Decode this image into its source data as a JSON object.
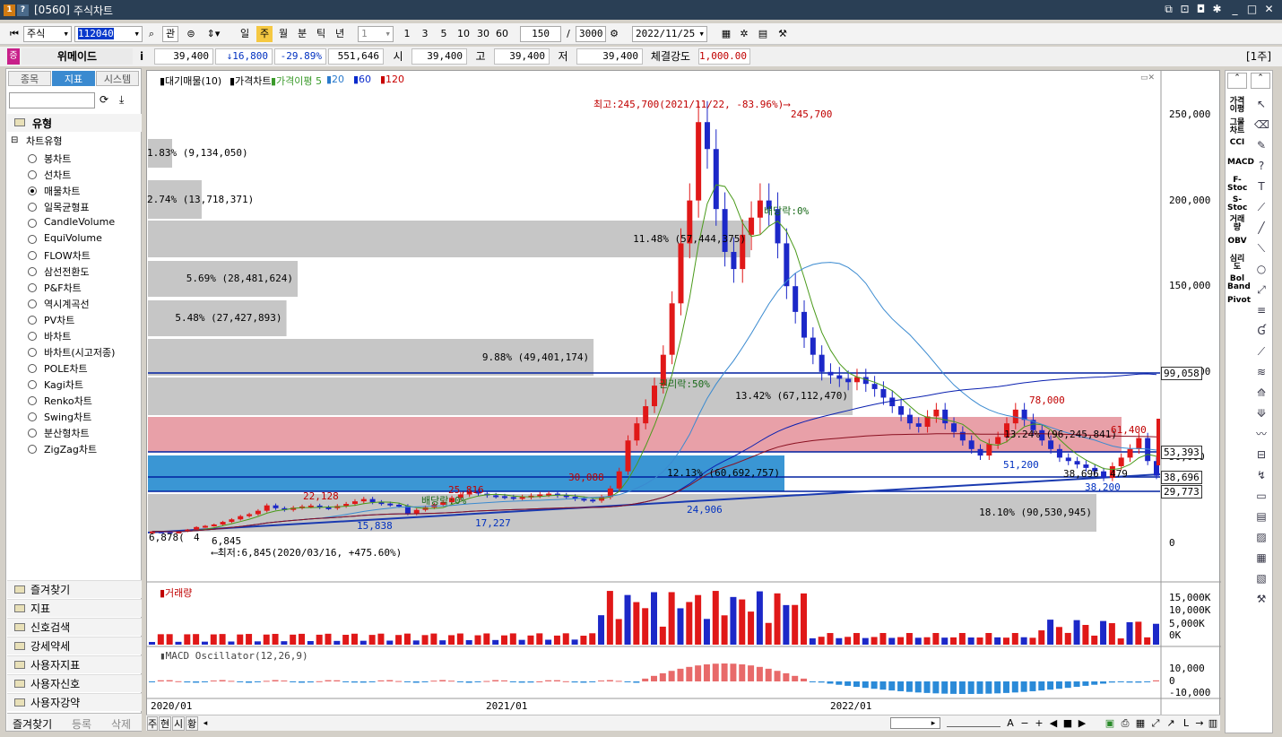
{
  "window": {
    "id": "[0560]",
    "title": "주식차트"
  },
  "toolbar": {
    "market": "주식",
    "code": "112040",
    "btn_gwan": "관",
    "periods": [
      "일",
      "주",
      "월",
      "분",
      "틱",
      "년"
    ],
    "nlist": "1",
    "nums": [
      "1",
      "3",
      "5",
      "10",
      "30",
      "60"
    ],
    "count": "150",
    "sep": "/",
    "max": "3000",
    "date": "2022/11/25"
  },
  "info": {
    "tag": "증",
    "name": "위메이드",
    "i": "i",
    "price": "39,400",
    "change": "↓16,800",
    "pct": "-29.89%",
    "volume": "551,646",
    "open_lbl": "시",
    "open": "39,400",
    "high_lbl": "고",
    "high": "39,400",
    "low_lbl": "저",
    "low": "39,400",
    "str_lbl": "체결강도",
    "strength": "1,000.00",
    "period": "[1주]"
  },
  "left": {
    "tabs": [
      "종목",
      "지표",
      "시스템"
    ],
    "section": "유형",
    "tree_root": "차트유형",
    "types": [
      "봉차트",
      "선차트",
      "매물차트",
      "일목균형표",
      "CandleVolume",
      "EquiVolume",
      "FLOW차트",
      "삼선전환도",
      "P&F차트",
      "역시계곡선",
      "PV차트",
      "바차트",
      "바차트(시고저종)",
      "POLE차트",
      "Kagi차트",
      "Renko차트",
      "Swing차트",
      "분산형차트",
      "ZigZag차트"
    ],
    "selected_index": 2,
    "folders": [
      "즐겨찾기",
      "지표",
      "신호검색",
      "강세약세",
      "사용자지표",
      "사용자신호",
      "사용자강약"
    ],
    "footer": [
      "즐겨찾기",
      "등록",
      "삭제"
    ]
  },
  "chart": {
    "legend": [
      "▮대기매물(10)",
      "▮가격차트",
      "▮가격이평 5",
      "▮20",
      "▮60",
      "▮120"
    ],
    "legend_colors": [
      "#000000",
      "#000000",
      "#3a9a2a",
      "#2a7acc",
      "#0a2acc",
      "#c80000"
    ],
    "vp": [
      {
        "label": "1.83% (9,134,050)",
        "fill": 0.25
      },
      {
        "label": "2.74% (13,718,371)",
        "fill": 0.37
      },
      {
        "label": "11.48% (57,444,375)",
        "fill": 1.0
      },
      {
        "label": "5.69% (28,481,624)",
        "fill": 0.5
      },
      {
        "label": "5.48% (27,427,893)",
        "fill": 0.48
      },
      {
        "label": "9.88% (49,401,174)",
        "fill": 0.86
      },
      {
        "label": "13.42% (67,112,470)",
        "fill": 1.0
      },
      {
        "label": "13.24% (96,245,841)",
        "fill": 1.0
      },
      {
        "label": "12.13% (60,692,757)",
        "fill": 1.0
      },
      {
        "label": "18.10% (90,530,945)",
        "fill": 1.0
      }
    ],
    "yticks": [
      "250,000",
      "200,000",
      "150,000",
      "100,000",
      "50,000",
      "0"
    ],
    "price_boxes": [
      "99,058",
      "53,393",
      "38,696",
      "29,773"
    ],
    "annotations": {
      "high": "최고:245,700(2021/11/22, -83.96%)⟶",
      "high_val": "245,700",
      "low": "⟵최저:6,845(2020/03/16, +475.60%)",
      "low_val": "6,845",
      "start": "6,878(",
      "start2": "4",
      "p22128": "22,128",
      "p15838": "15,838",
      "p25816": "25,816",
      "p17227": "17,227",
      "p30088": "30,088",
      "p24906": "24,906",
      "p78000": "78,000",
      "p51200": "51,200",
      "p61400": "61,400",
      "p38200": "38,200",
      "p38696": "38,696",
      "p479": "479",
      "div1": "배당락:0%",
      "div2": "배당락:0%",
      "rights": "권리락:50%"
    },
    "xlabels": [
      "2020/01",
      "2021/01",
      "2022/01"
    ]
  },
  "volume_pane": {
    "title": "▮거래량",
    "ticks": [
      "15,000K",
      "10,000K",
      "5,000K",
      "0K"
    ]
  },
  "macd_pane": {
    "title": "▮MACD Oscillator(12,26,9)",
    "ticks": [
      "10,000",
      "0",
      "-10,000"
    ]
  },
  "right": {
    "indicators": [
      "가격이평",
      "그물차트",
      "CCI",
      "MACD",
      "F-Stoc",
      "S-Stoc",
      "거래량",
      "OBV",
      "심리도",
      "Bol Band",
      "Pivot"
    ]
  },
  "bottom": {
    "tabs": [
      "주",
      "현",
      "시",
      "황"
    ],
    "tools": [
      "A",
      "−",
      "+",
      "◀",
      "■",
      "▶"
    ]
  }
}
